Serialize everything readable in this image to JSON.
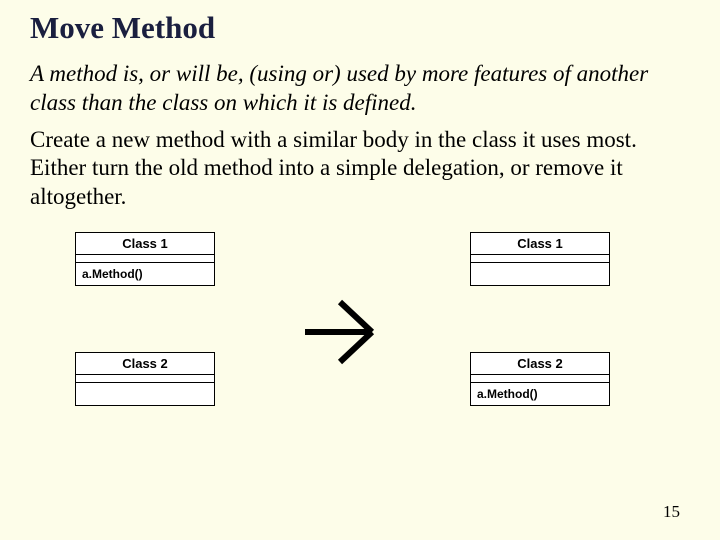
{
  "title": "Move Method",
  "intro_italic": "A method is, or will be, (using or) used by more features of another class than the class on which it is defined.",
  "intro_normal": "Create a new method with a similar body in the class it uses most. Either turn the old method into a simple delegation, or remove it altogether.",
  "diagram": {
    "left": {
      "class1": {
        "name": "Class 1",
        "method": "a.Method()"
      },
      "class2": {
        "name": "Class 2",
        "method": ""
      }
    },
    "right": {
      "class1": {
        "name": "Class 1",
        "method": ""
      },
      "class2": {
        "name": "Class 2",
        "method": "a.Method()"
      }
    }
  },
  "page_number": "15"
}
